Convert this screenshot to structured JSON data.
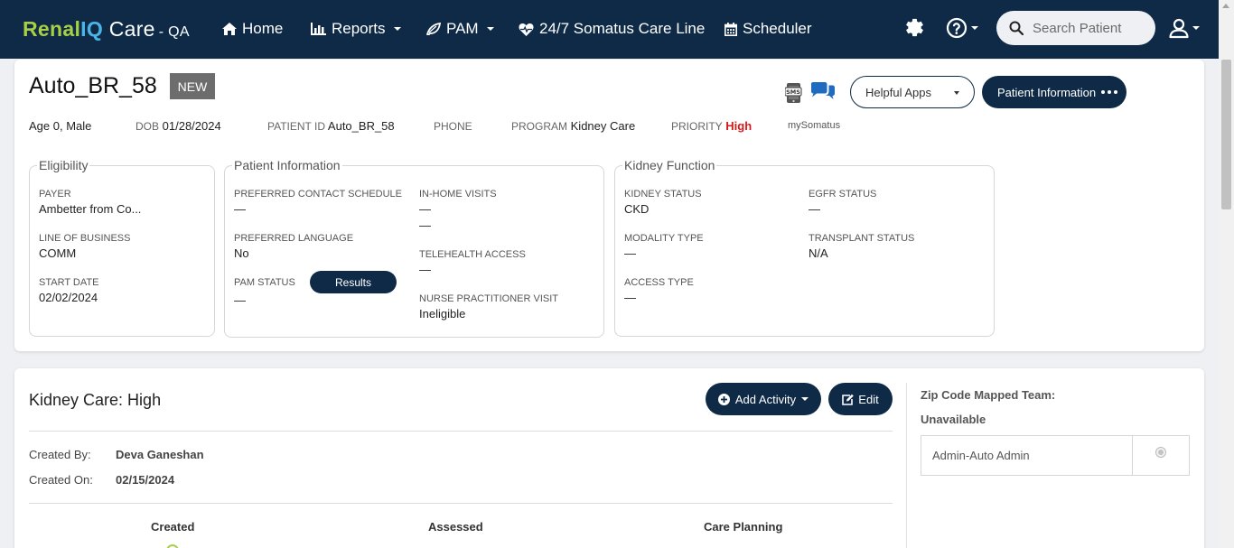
{
  "brand": {
    "part1": "Renal",
    "part2": "IQ",
    "part3": " Care",
    "env": "- QA"
  },
  "nav": {
    "home": "Home",
    "reports": "Reports",
    "pam": "PAM",
    "care_line": "24/7 Somatus Care Line",
    "scheduler": "Scheduler"
  },
  "search": {
    "placeholder": "Search Patient"
  },
  "patient": {
    "name": "Auto_BR_58",
    "badge": "NEW",
    "age_sex": "Age 0, Male",
    "dob_label": "DOB",
    "dob": "01/28/2024",
    "pid_label": "PATIENT ID",
    "pid": "Auto_BR_58",
    "phone_label": "PHONE",
    "program_label": "PROGRAM",
    "program": "Kidney Care",
    "priority_label": "PRIORITY",
    "priority": "High",
    "my_somatus": "mySomatus"
  },
  "actions": {
    "helpful_apps": "Helpful Apps",
    "patient_information": "Patient Information"
  },
  "eligibility": {
    "title": "Eligibility",
    "payer_label": "PAYER",
    "payer": "Ambetter from Co...",
    "lob_label": "LINE OF BUSINESS",
    "lob": "COMM",
    "start_label": "START DATE",
    "start": "02/02/2024"
  },
  "patient_info": {
    "title": "Patient Information",
    "contact_label": "PREFERRED CONTACT SCHEDULE",
    "contact": "—",
    "language_label": "PREFERRED LANGUAGE",
    "language": "No",
    "pam_label": "PAM STATUS",
    "pam": "—",
    "results_btn": "Results",
    "inhome_label": "IN-HOME VISITS",
    "inhome_1": "—",
    "inhome_2": "—",
    "telehealth_label": "TELEHEALTH ACCESS",
    "telehealth": "—",
    "np_label": "NURSE PRACTITIONER VISIT",
    "np": "Ineligible"
  },
  "kidney": {
    "title": "Kidney Function",
    "status_label": "KIDNEY STATUS",
    "status": "CKD",
    "egfr_label": "EGFR STATUS",
    "egfr": "—",
    "modality_label": "MODALITY TYPE",
    "modality": "—",
    "transplant_label": "TRANSPLANT STATUS",
    "transplant": "N/A",
    "access_label": "ACCESS TYPE",
    "access": "—"
  },
  "care": {
    "title": "Kidney Care: High",
    "add_activity": "Add Activity",
    "edit": "Edit",
    "created_by_label": "Created By:",
    "created_by": "Deva Ganeshan",
    "created_on_label": "Created On:",
    "created_on": "02/15/2024",
    "stages": [
      "Created",
      "Assessed",
      "Care Planning"
    ]
  },
  "zip": {
    "label": "Zip Code Mapped Team:",
    "status": "Unavailable",
    "team": "Admin-Auto Admin"
  },
  "colors": {
    "navbar": "#0e2a47",
    "brand_green": "#a8cf45",
    "brand_blue": "#4ab5e6",
    "priority_high": "#d71a1a"
  },
  "icons": [
    "home-icon",
    "bar-chart-icon",
    "leaf-icon",
    "heart-pulse-icon",
    "calendar-icon",
    "gear-icon",
    "help-icon",
    "search-icon",
    "user-icon",
    "sms-icon",
    "chat-icon",
    "plus-circle-icon",
    "edit-icon"
  ]
}
